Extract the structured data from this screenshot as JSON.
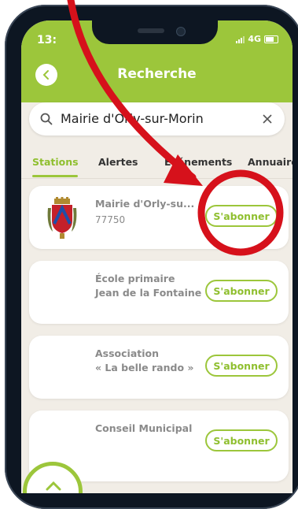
{
  "status": {
    "time": "13:",
    "network": "4G"
  },
  "header": {
    "title": "Recherche"
  },
  "search": {
    "value": "Mairie d'Orly-sur-Morin"
  },
  "tabs": [
    {
      "label": "Stations",
      "active": true
    },
    {
      "label": "Alertes"
    },
    {
      "label": "Événements"
    },
    {
      "label": "Annuaire"
    }
  ],
  "results": [
    {
      "name": "Mairie d'Orly-su...",
      "subtitle": "77750",
      "button": "S'abonner"
    },
    {
      "name_line1": "École primaire",
      "name_line2": "Jean de la Fontaine",
      "button": "S'abonner"
    },
    {
      "name_line1": "Association",
      "name_line2": "« La belle rando »",
      "button": "S'abonner"
    },
    {
      "name": "Conseil Municipal",
      "button": "S'abonner"
    }
  ],
  "colors": {
    "brand_green": "#9cc63b",
    "annotation_red": "#d6111b",
    "background": "#f1ede6"
  },
  "icons": [
    "back-arrow-icon",
    "search-icon",
    "clear-icon",
    "crest-icon",
    "chevron-up-icon"
  ]
}
